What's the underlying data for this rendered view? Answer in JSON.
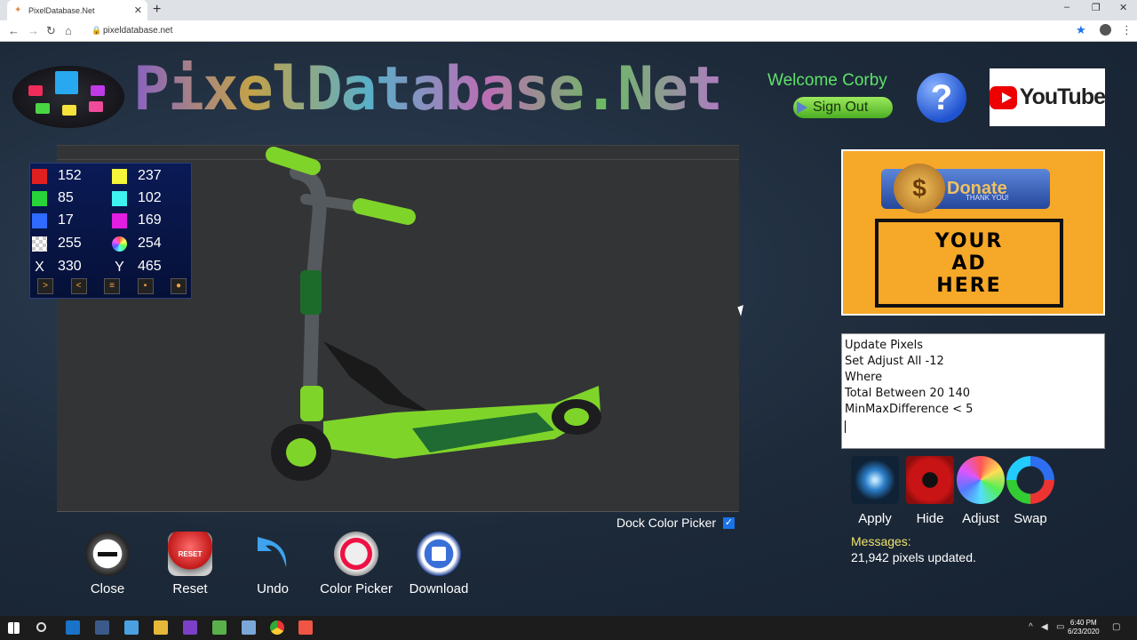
{
  "browser": {
    "tab_title": "PixelDatabase.Net",
    "tab_close": "✕",
    "new_tab": "+",
    "url": "pixeldatabase.net",
    "back": "←",
    "forward": "→",
    "reload": "↻",
    "home": "⌂",
    "lock": "🔒",
    "star": "★",
    "menu": "⋮",
    "minimize": "–",
    "maximize": "❐",
    "close": "✕"
  },
  "header": {
    "site_title": "PixelDatabase.Net",
    "welcome": "Welcome Corby",
    "signout_label": "Sign Out",
    "help_glyph": "?",
    "youtube_label": "YouTube"
  },
  "picker": {
    "red": "152",
    "green": "85",
    "blue": "17",
    "alpha": "255",
    "yellow": "237",
    "cyan": "102",
    "magenta": "169",
    "total": "254",
    "x_label": "X",
    "x_value": "330",
    "y_label": "Y",
    "y_value": "465",
    "colors": {
      "red": "#e02020",
      "green": "#27d43a",
      "blue": "#2f6bff",
      "yellow": "#f5f53a",
      "cyan": "#3ff2f2",
      "magenta": "#e21ee2"
    }
  },
  "dock": {
    "label": "Dock Color Picker",
    "checked": "✓"
  },
  "tools": {
    "close": "Close",
    "reset": "Reset",
    "undo": "Undo",
    "color_picker": "Color Picker",
    "download": "Download",
    "reset_badge": "RESET"
  },
  "ad": {
    "donate": "Donate",
    "thanks": "THANK YOU!",
    "coin": "$",
    "line1": "YOUR",
    "line2": "AD",
    "line3": "HERE"
  },
  "editor": {
    "lines": [
      "Update Pixels",
      "Set Adjust All -12",
      "Where",
      "Total Between 20 140",
      "MinMaxDifference < 5"
    ]
  },
  "actions": {
    "apply": "Apply",
    "hide": "Hide",
    "adjust": "Adjust",
    "swap": "Swap"
  },
  "messages": {
    "label": "Messages:",
    "text": "21,942 pixels updated."
  },
  "taskbar": {
    "time": "6:40 PM",
    "date": "6/23/2020"
  }
}
